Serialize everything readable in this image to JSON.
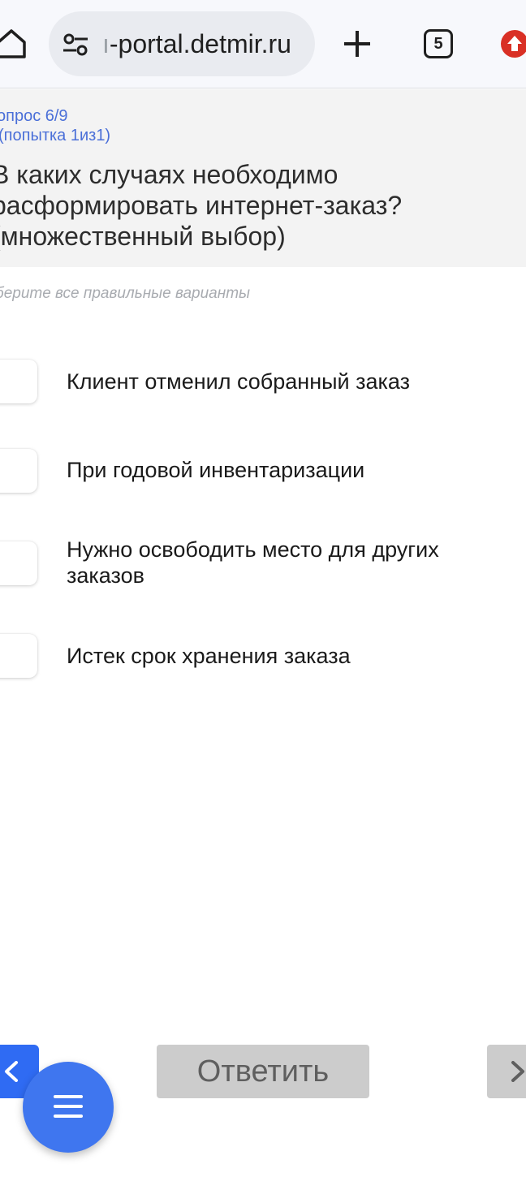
{
  "browser": {
    "url_prefix_faded": "ı",
    "url_text": "-portal.detmir.ru",
    "tab_count": "5"
  },
  "question": {
    "counter": "опрос 6/9",
    "attempt": "(попытка 1из1)",
    "text": "В каких случаях необходимо расформировать интернет-заказ? (множественный выбор)",
    "hint": "берите все правильные варианты"
  },
  "options": [
    {
      "label": "Клиент отменил собранный заказ",
      "checked": false
    },
    {
      "label": "При годовой инвентаризации",
      "checked": false
    },
    {
      "label": "Нужно освободить место для других заказов",
      "checked": false
    },
    {
      "label": "Истек срок хранения заказа",
      "checked": false
    }
  ],
  "footer": {
    "answer_label": "Ответить"
  },
  "colors": {
    "accent_blue": "#2f6bf3",
    "question_counter": "#4a6fd8",
    "disabled_button": "#cccccc"
  }
}
